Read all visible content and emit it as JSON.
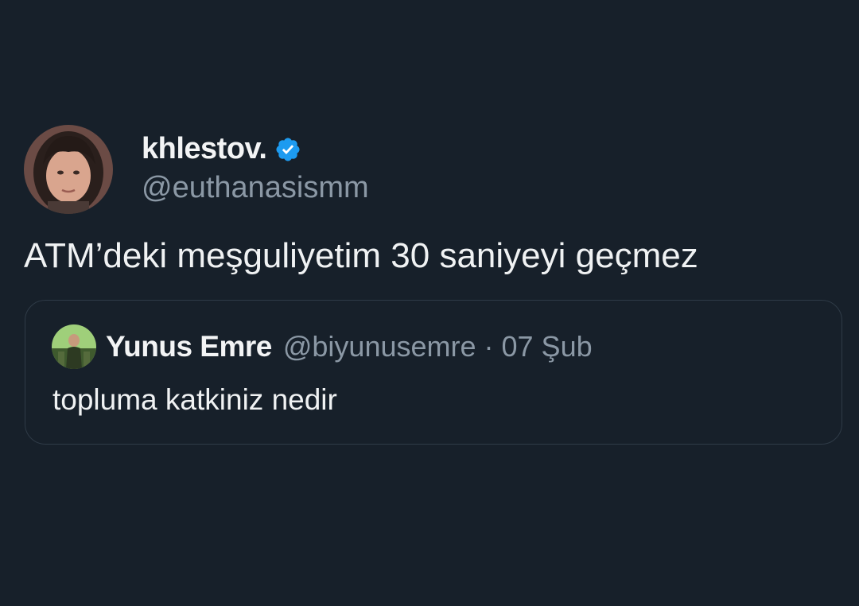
{
  "tweet": {
    "author": {
      "display_name": "khlestov.",
      "handle": "@euthanasismm",
      "verified": true,
      "avatar_icon": "profile-photo"
    },
    "text": "ATM’deki meşguliyetim 30 saniyeyi geçmez"
  },
  "quoted_tweet": {
    "author": {
      "display_name": "Yunus Emre",
      "handle": "@biyunusemre",
      "avatar_icon": "profile-photo"
    },
    "separator": "·",
    "date": "07 Şub",
    "text": "topluma katkiniz nedir"
  },
  "colors": {
    "background": "#17202a",
    "text_primary": "#f0f2f3",
    "text_secondary": "#8b98a5",
    "verified_badge": "#1d9bf0",
    "quote_border": "#2f3b47"
  }
}
